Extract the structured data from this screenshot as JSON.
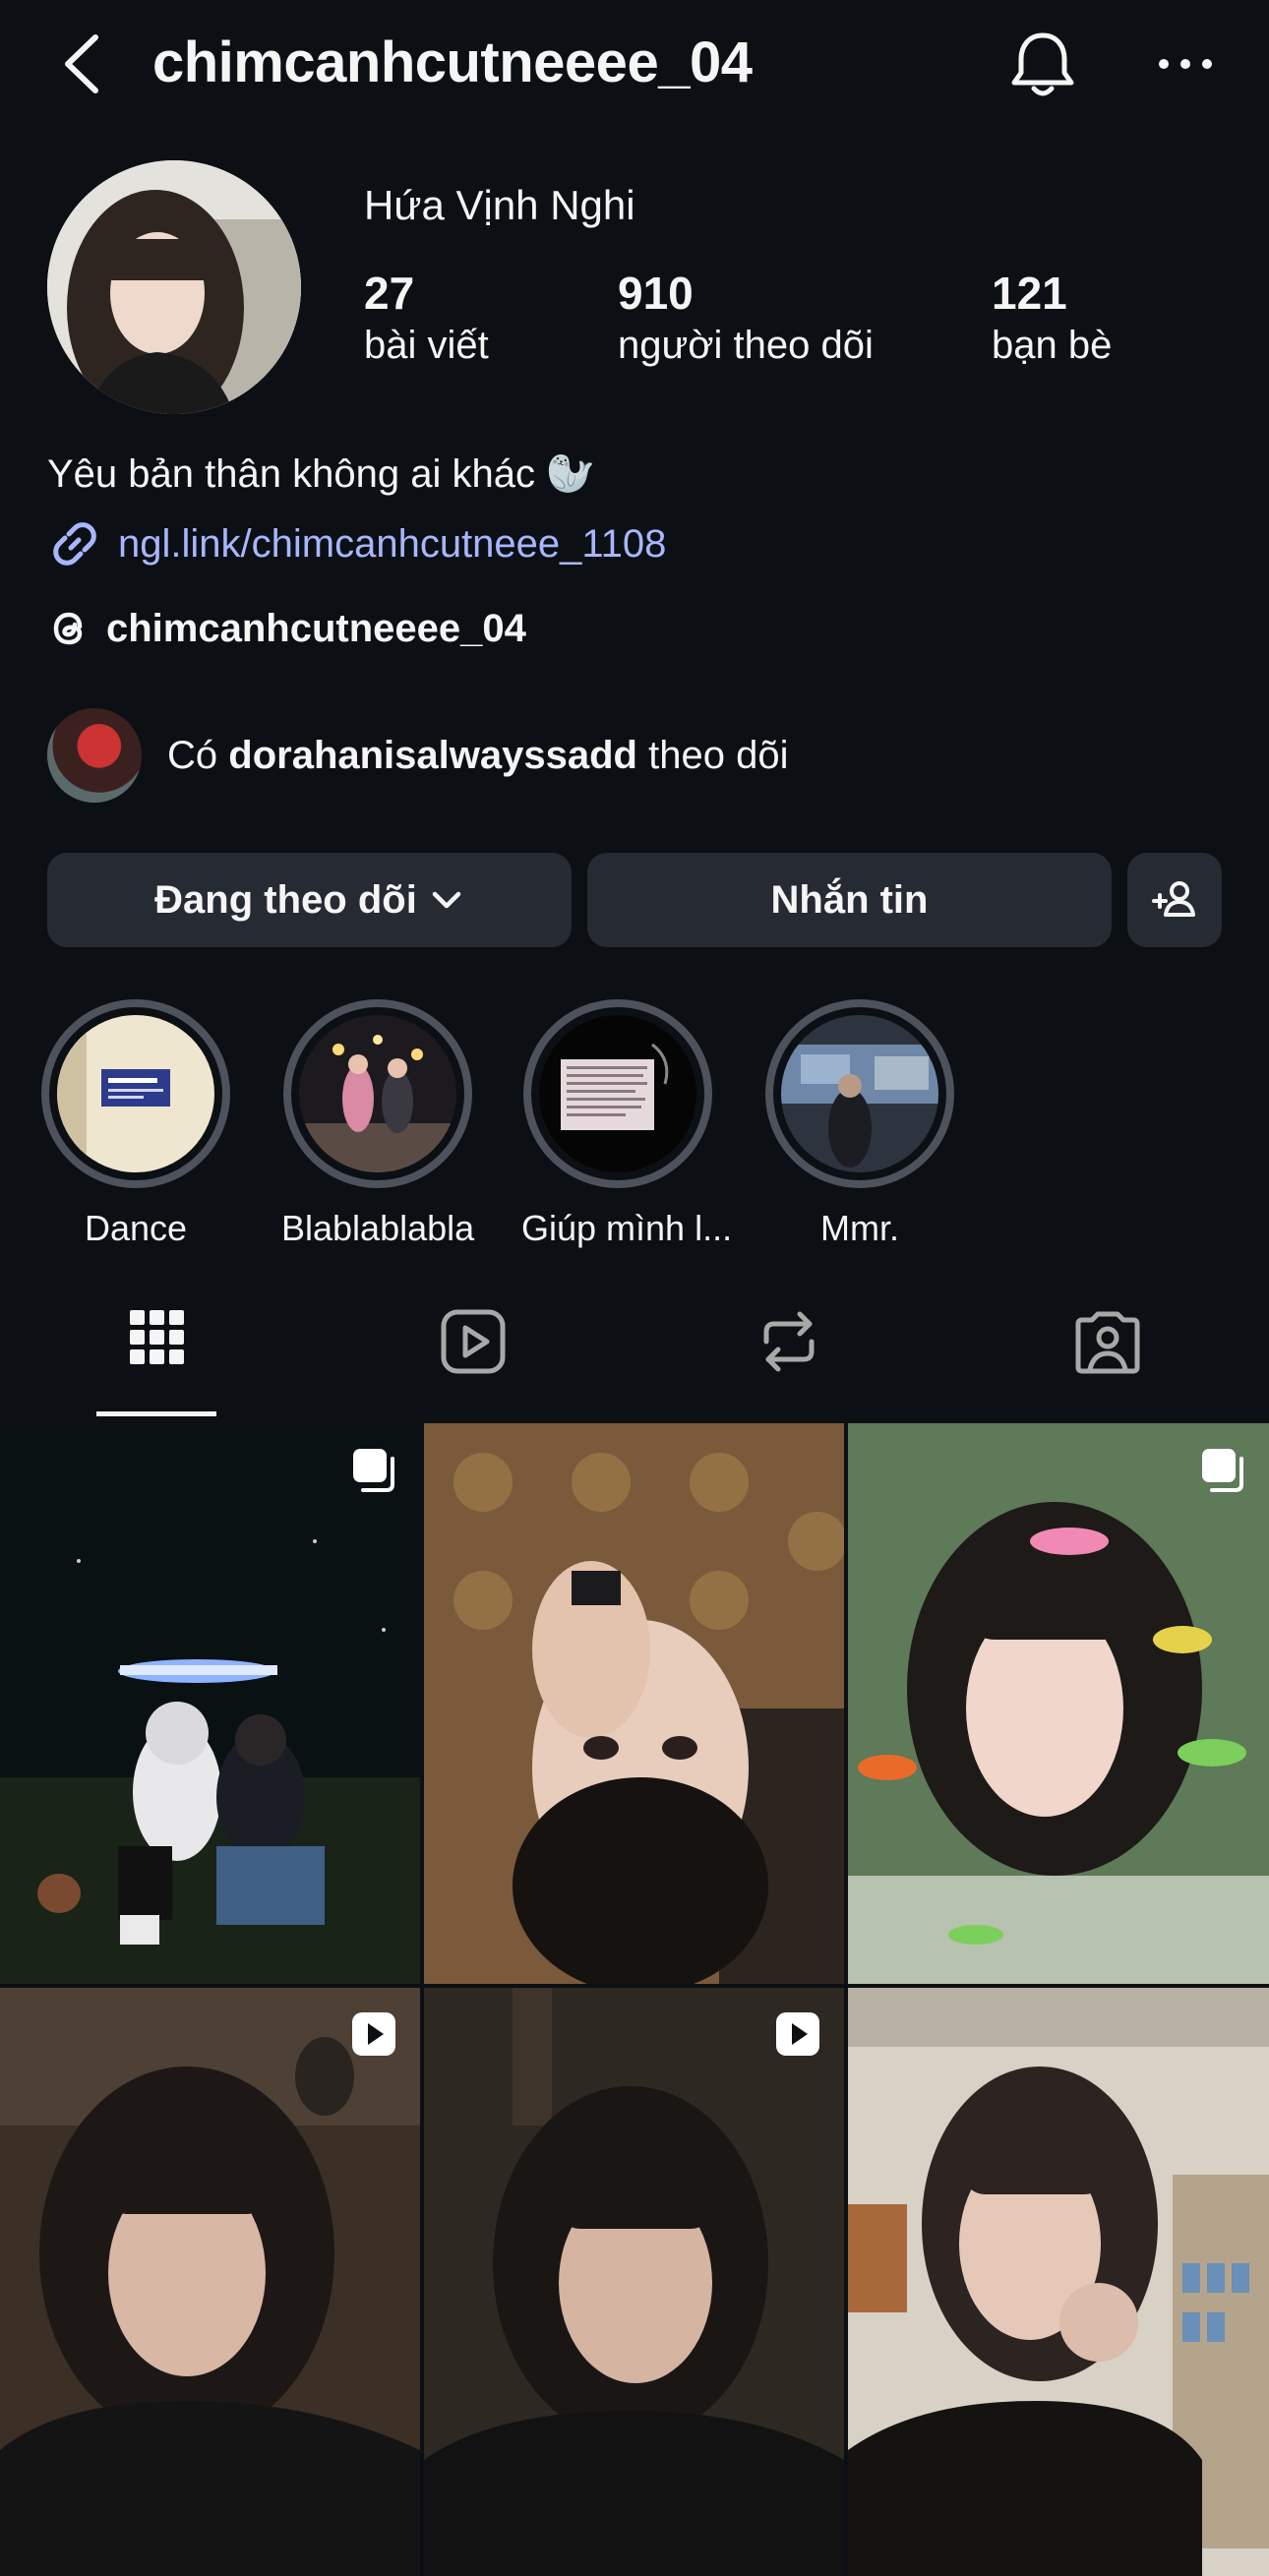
{
  "header": {
    "username": "chimcanhcutneeee_04"
  },
  "profile": {
    "display_name": "Hứa Vịnh Nghi",
    "stats": [
      {
        "count": "27",
        "label": "bài viết"
      },
      {
        "count": "910",
        "label": "người theo dõi"
      },
      {
        "count": "121",
        "label": "bạn bè"
      }
    ],
    "bio": "Yêu bản thân không ai khác 🦭",
    "link": "ngl.link/chimcanhcutneee_1108",
    "threads_handle": "chimcanhcutneeee_04",
    "mutual": {
      "prefix": "Có",
      "name": "dorahanisalwayssadd",
      "suffix": "theo dõi"
    }
  },
  "actions": {
    "following_label": "Đang theo dõi",
    "message_label": "Nhắn tin"
  },
  "highlights": [
    {
      "label": "Dance"
    },
    {
      "label": "Blablablabla"
    },
    {
      "label": "Giúp mình l..."
    },
    {
      "label": "Mmr."
    }
  ],
  "tabs": [
    "posts-grid",
    "reels",
    "reposts",
    "tagged"
  ],
  "colors": {
    "background": "#0c1014",
    "button": "#262a33",
    "link": "#a8b6ff",
    "ring": "#4e525c"
  },
  "grid_posts": [
    {
      "type": "carousel"
    },
    {
      "type": "photo"
    },
    {
      "type": "carousel"
    },
    {
      "type": "reel"
    },
    {
      "type": "reel"
    },
    {
      "type": "photo"
    }
  ]
}
